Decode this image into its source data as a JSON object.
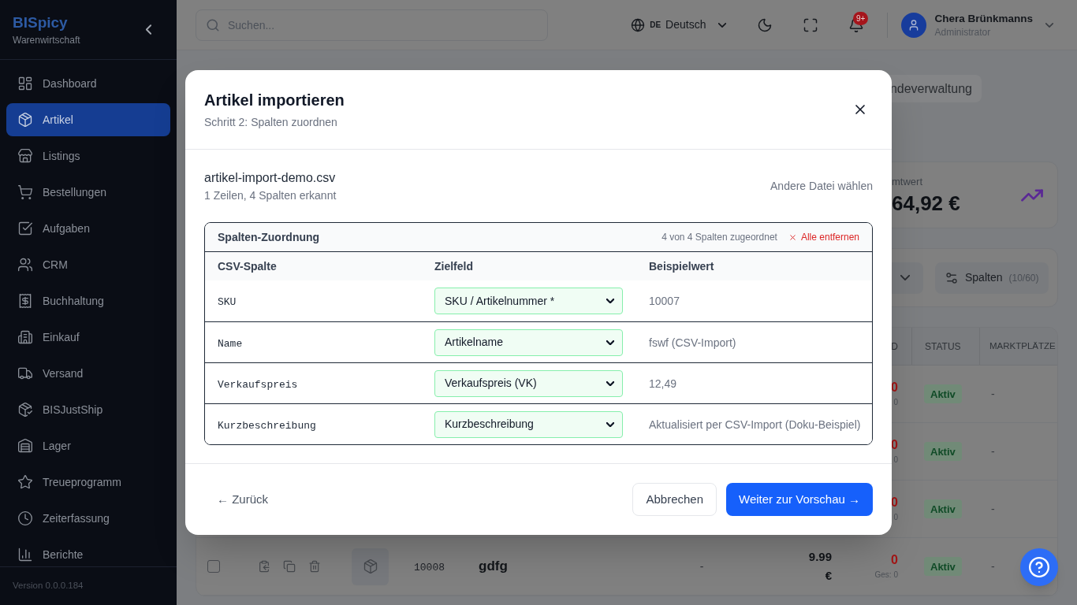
{
  "sidebar": {
    "logo": "BISpicy",
    "subtitle": "Warenwirtschaft",
    "items": [
      {
        "label": "Dashboard",
        "selected": false
      },
      {
        "label": "Artikel",
        "selected": true
      },
      {
        "label": "Listings",
        "selected": false
      },
      {
        "label": "Bestellungen",
        "selected": false
      },
      {
        "label": "Aufgaben",
        "selected": false
      },
      {
        "label": "CRM",
        "selected": false
      },
      {
        "label": "Buchhaltung",
        "selected": false
      },
      {
        "label": "Einkauf",
        "selected": false
      },
      {
        "label": "Versand",
        "selected": false
      },
      {
        "label": "BISJustShip",
        "selected": false
      },
      {
        "label": "Lager",
        "selected": false
      },
      {
        "label": "Treueprogramm",
        "selected": false
      },
      {
        "label": "Zeiterfassung",
        "selected": false
      },
      {
        "label": "Berichte",
        "selected": false
      }
    ],
    "version": "Version 0.0.0.184"
  },
  "topbar": {
    "search": {
      "placeholder": "Suchen..."
    },
    "language": {
      "code": "DE",
      "label": "Deutsch"
    },
    "notifications": {
      "badge": "9+"
    },
    "user": {
      "name": "Chera Brünkmanns",
      "role": "Administrator"
    }
  },
  "page": {
    "tab": {
      "label": "ndeverwaltung"
    },
    "stat_card": {
      "label": "mtwert",
      "value": "64,92 €"
    },
    "columns_button": {
      "label": "Spalten",
      "count": "(10/60)"
    },
    "table": {
      "columns": [
        "D",
        "STATUS",
        "MARKTPLÄTZE"
      ],
      "rows": [
        {
          "column_8": "0",
          "column_8_note": "0",
          "status": "Aktiv",
          "marketplaces": "-"
        },
        {
          "column_8": "0",
          "column_8_note": "0",
          "status": "Aktiv",
          "marketplaces": "-"
        },
        {
          "column_8": "0",
          "column_8_note": "0",
          "status": "Aktiv",
          "marketplaces": "-"
        },
        {
          "checked": false,
          "column_4": "10008",
          "column_5": "gdfg",
          "column_6": "-",
          "column_7": "9.99 €",
          "column_8": "0",
          "column_8_note": "Ges: 0",
          "status": "Aktiv",
          "marketplaces": "-"
        }
      ]
    }
  },
  "dialog": {
    "title": "Artikel importieren",
    "subtitle": "Schritt 2: Spalten zuordnen",
    "file": {
      "name": "artikel-import-demo.csv",
      "info": "1 Zeilen, 4 Spalten erkannt",
      "change_link": "Andere Datei wählen"
    },
    "mapping": {
      "title": "Spalten-Zuordnung",
      "summary": "4 von 4 Spalten zugeordnet",
      "clear_all": "Alle entfernen",
      "columns": [
        "CSV-Spalte",
        "Zielfeld",
        "Beispielwert"
      ],
      "rows": [
        {
          "csv_column": "SKU",
          "target_field": "SKU / Artikelnummer *",
          "mapped": true,
          "sample": "10007"
        },
        {
          "csv_column": "Name",
          "target_field": "Artikelname",
          "mapped": true,
          "sample": "fswf (CSV-Import)"
        },
        {
          "csv_column": "Verkaufspreis",
          "target_field": "Verkaufspreis (VK)",
          "mapped": true,
          "sample": "12,49"
        },
        {
          "csv_column": "Kurzbeschreibung",
          "target_field": "Kurzbeschreibung",
          "mapped": true,
          "sample": "Aktualisiert per CSV-Import (Doku-Beispiel)"
        }
      ]
    },
    "back_button": "← Zurück",
    "cancel_button": "Abbrechen",
    "next_button": "Weiter zur Vorschau →"
  }
}
